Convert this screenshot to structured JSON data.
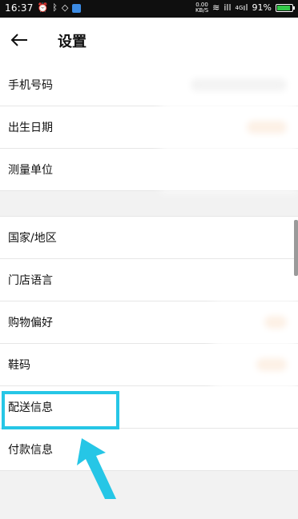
{
  "status_bar": {
    "time": "16:37",
    "left_icons": [
      "alarm-icon",
      "bluetooth-icon",
      "shield-icon",
      "app-icon"
    ],
    "net_speed_value": "0.00",
    "net_speed_unit": "KB/S",
    "signal_1": "ill",
    "signal_2_label": "4G",
    "battery_percent_text": "91%",
    "battery_level": 0.91
  },
  "header": {
    "title": "设置",
    "back_icon": "arrow-left-icon"
  },
  "settings": {
    "group1": [
      {
        "label": "手机号码"
      },
      {
        "label": "出生日期"
      },
      {
        "label": "测量单位"
      }
    ],
    "group2": [
      {
        "label": "国家/地区"
      },
      {
        "label": "门店语言"
      },
      {
        "label": "购物偏好"
      },
      {
        "label": "鞋码"
      },
      {
        "label": "配送信息"
      },
      {
        "label": "付款信息"
      }
    ]
  },
  "colors": {
    "highlight": "#26c6e6",
    "status_bar_bg": "#0f0f0f",
    "section_bg": "#f2f2f2",
    "blurred_value_orange": "#f5c49a",
    "blurred_value_gray": "#cfcfcf"
  }
}
